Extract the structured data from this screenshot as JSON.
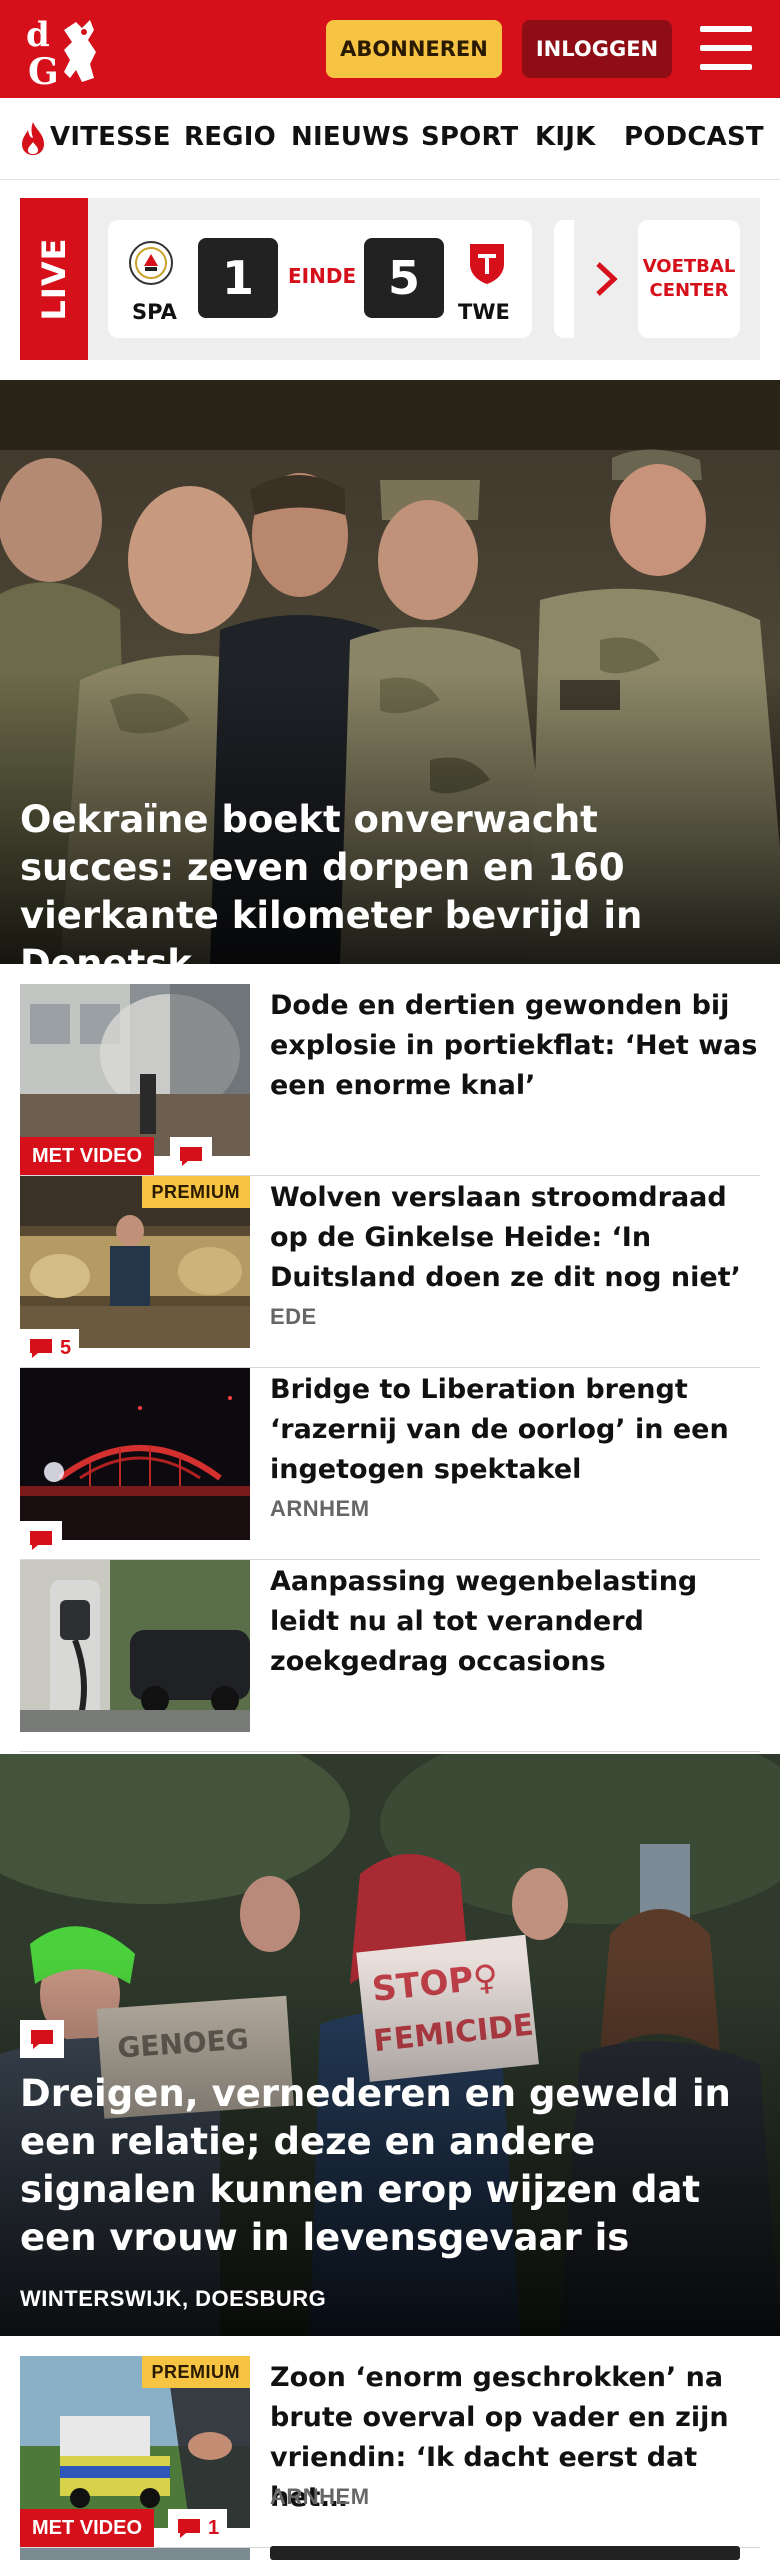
{
  "header": {
    "logo_alt": "dG",
    "subscribe_label": "ABONNEREN",
    "login_label": "INLOGGEN",
    "brand_color": "#d5101a"
  },
  "nav": {
    "items": [
      {
        "label": "VITESSE",
        "icon": "flame-icon"
      },
      {
        "label": "REGIO"
      },
      {
        "label": "NIEUWS"
      },
      {
        "label": "SPORT"
      },
      {
        "label": "KIJK"
      },
      {
        "label": "PODCAST"
      }
    ]
  },
  "live": {
    "tag": "LIVE",
    "match": {
      "home": "SPA",
      "home_score": "1",
      "status": "EINDE",
      "away_score": "5",
      "away": "TWE"
    },
    "center_label_line1": "VOETBAL",
    "center_label_line2": "CENTER"
  },
  "hero": {
    "title": "Oekraïne boekt onverwacht succes: zeven dorpen en 160 vierkante kilometer bevrijd in Donetsk"
  },
  "articles": [
    {
      "title": "Dode en dertien gewonden bij explosie in portiekflat: ‘Het was een enorme knal’",
      "video": "MET VIDEO",
      "comment": true
    },
    {
      "title": "Wolven verslaan stroomdraad op de Ginkelse Heide: ‘In Duitsland doen ze dit nog niet’",
      "location": "EDE",
      "premium": "PREMIUM",
      "comment_count": "5"
    },
    {
      "title": "Bridge to Liberation brengt ‘razernij van de oorlog’ in een ingetogen spektakel",
      "location": "ARNHEM",
      "comment": true
    },
    {
      "title": "Aanpassing wegenbelasting leidt nu al tot veranderd zoekgedrag occasions"
    }
  ],
  "hero2": {
    "title": "Dreigen, vernederen en geweld in een relatie; deze en andere signalen kunnen erop wijzen dat een vrouw in levensgevaar is",
    "location": "WINTERSWIJK, DOESBURG",
    "sign_text": "STOP FEMICIDE"
  },
  "article_last": {
    "title": "Zoon ‘enorm geschrokken’ na brute overval op vader en zijn vriendin: ‘Ik dacht eerst dat het…",
    "location": "ARNHEM",
    "premium": "PREMIUM",
    "video": "MET VIDEO",
    "comment_count": "1"
  }
}
